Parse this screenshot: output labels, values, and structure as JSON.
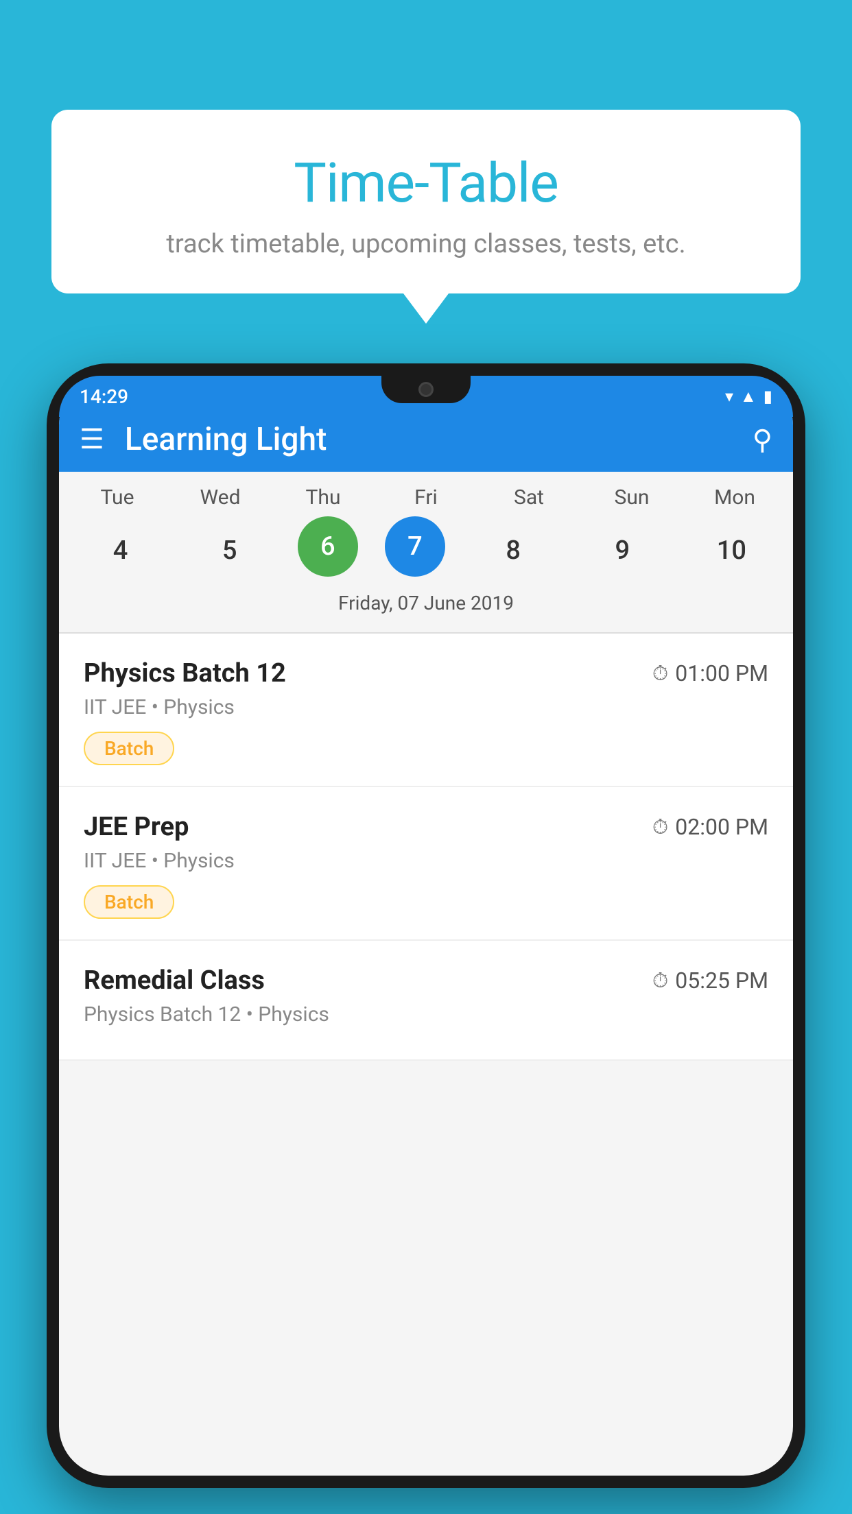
{
  "background_color": "#29B6D8",
  "tooltip": {
    "title": "Time-Table",
    "subtitle": "track timetable, upcoming classes, tests, etc."
  },
  "phone": {
    "status_bar": {
      "time": "14:29",
      "icons": [
        "wifi",
        "signal",
        "battery"
      ]
    },
    "app": {
      "title": "Learning Light",
      "header_color": "#1E88E5"
    },
    "calendar": {
      "days": [
        {
          "name": "Tue",
          "number": "4",
          "state": "normal"
        },
        {
          "name": "Wed",
          "number": "5",
          "state": "normal"
        },
        {
          "name": "Thu",
          "number": "6",
          "state": "today"
        },
        {
          "name": "Fri",
          "number": "7",
          "state": "selected"
        },
        {
          "name": "Sat",
          "number": "8",
          "state": "normal"
        },
        {
          "name": "Sun",
          "number": "9",
          "state": "normal"
        },
        {
          "name": "Mon",
          "number": "10",
          "state": "normal"
        }
      ],
      "selected_date_label": "Friday, 07 June 2019"
    },
    "classes": [
      {
        "name": "Physics Batch 12",
        "time": "01:00 PM",
        "meta": "IIT JEE • Physics",
        "badge": "Batch"
      },
      {
        "name": "JEE Prep",
        "time": "02:00 PM",
        "meta": "IIT JEE • Physics",
        "badge": "Batch"
      },
      {
        "name": "Remedial Class",
        "time": "05:25 PM",
        "meta": "Physics Batch 12 • Physics",
        "badge": null
      }
    ]
  }
}
